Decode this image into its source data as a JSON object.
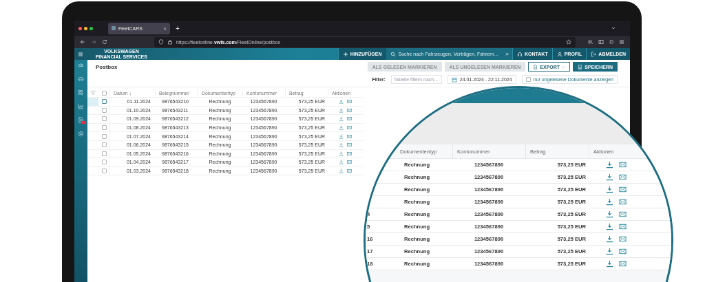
{
  "browser": {
    "tab": {
      "title": "FleetCARS",
      "close": "×",
      "selected": true
    },
    "new_tab": "+",
    "url": {
      "prefix": "https://fleetonline.",
      "domain": "vwfs.com",
      "path": "/FleetOnline/postbox"
    }
  },
  "app_header": {
    "logo": [
      "VOLKSWAGEN",
      "FINANCIAL SERVICES"
    ],
    "add_button": "HINZUFÜGEN",
    "search": {
      "placeholder": "Suche nach Fahrzeugen, Verträgen, Fahrern..."
    },
    "search_go": ">",
    "actions": [
      {
        "kind": "contact",
        "label": "KONTAKT"
      },
      {
        "kind": "profile",
        "label": "PROFIL"
      },
      {
        "kind": "logout",
        "label": "ABMELDEN"
      }
    ]
  },
  "sidebar": {
    "items": [
      {
        "kind": "gauge"
      },
      {
        "kind": "car"
      },
      {
        "kind": "fleet"
      },
      {
        "kind": "chart"
      },
      {
        "kind": "document",
        "badge": true
      },
      {
        "kind": "gear"
      }
    ]
  },
  "page": {
    "title": "Postbox",
    "buttons": [
      {
        "kind": "plain",
        "label": "ALS GELESEN MARKIEREN",
        "disabled": true
      },
      {
        "kind": "plain",
        "label": "ALS UNGELESEN MARKIEREN",
        "disabled": true
      },
      {
        "kind": "export",
        "label": "EXPORT",
        "disabled": false
      },
      {
        "kind": "save",
        "label": "SPEICHERN",
        "disabled": false
      }
    ],
    "filter": {
      "label": "Filter:",
      "placeholder": "Tabelle filtern nach...",
      "date_range": "24.01.2024 - 22.11.2024",
      "unread_only": {
        "label": "nur ungelesene Dokumente anzeigen",
        "checked": false
      }
    }
  },
  "table": {
    "select_all": {
      "checked": false
    },
    "columns": [
      "Datum ↓",
      "Belegnummer",
      "Dokumententyp",
      "Kontonummer",
      "Betrag",
      "Aktionen"
    ],
    "rows": [
      {
        "datum": "01.11.2024",
        "beleg": "9876543210",
        "typ": "Rechnung",
        "konto": "1234567890",
        "betrag": "573,25 EUR",
        "selected": true,
        "checked": false
      },
      {
        "datum": "01.10.2024",
        "beleg": "9876543211",
        "typ": "Rechnung",
        "konto": "1234567890",
        "betrag": "573,25 EUR",
        "selected": false,
        "checked": false
      },
      {
        "datum": "01.09.2024",
        "beleg": "9876543212",
        "typ": "Rechnung",
        "konto": "1234567890",
        "betrag": "573,25 EUR",
        "selected": false,
        "checked": false
      },
      {
        "datum": "01.08.2024",
        "beleg": "9876543213",
        "typ": "Rechnung",
        "konto": "1234567890",
        "betrag": "573,25 EUR",
        "selected": false,
        "checked": false
      },
      {
        "datum": "01.07.2024",
        "beleg": "9876543214",
        "typ": "Rechnung",
        "konto": "1234567890",
        "betrag": "573,25 EUR",
        "selected": false,
        "checked": false
      },
      {
        "datum": "01.06.2024",
        "beleg": "9876543215",
        "typ": "Rechnung",
        "konto": "1234567890",
        "betrag": "573,25 EUR",
        "selected": false,
        "checked": false
      },
      {
        "datum": "01.05.2024",
        "beleg": "9876543216",
        "typ": "Rechnung",
        "konto": "1234567890",
        "betrag": "573,25 EUR",
        "selected": false,
        "checked": false
      },
      {
        "datum": "01.04.2024",
        "beleg": "9876543217",
        "typ": "Rechnung",
        "konto": "1234567890",
        "betrag": "573,25 EUR",
        "selected": false,
        "checked": false
      },
      {
        "datum": "01.03.2024",
        "beleg": "9876543218",
        "typ": "Rechnung",
        "konto": "1234567890",
        "betrag": "573,25 EUR",
        "selected": false,
        "checked": false
      }
    ]
  },
  "magnifier": {
    "columns": [
      "Dokumententyp",
      "Kontonummer",
      "Betrag",
      "Aktionen"
    ],
    "rows": [
      {
        "typ": "Rechnung",
        "konto": "1234567890",
        "betrag": "573,25 EUR"
      },
      {
        "typ": "Rechnung",
        "konto": "1234567890",
        "betrag": "573,25 EUR"
      },
      {
        "typ": "Rechnung",
        "konto": "1234567890",
        "betrag": "573,25 EUR"
      },
      {
        "typ": "Rechnung",
        "konto": "1234567890",
        "betrag": "573,25 EUR"
      },
      {
        "column_1": "4",
        "typ": "Rechnung",
        "konto": "1234567890",
        "betrag": "573,25 EUR"
      },
      {
        "column_1": "5",
        "typ": "Rechnung",
        "konto": "1234567890",
        "betrag": "573,25 EUR"
      },
      {
        "column_1": "16",
        "typ": "Rechnung",
        "konto": "1234567890",
        "betrag": "573,25 EUR"
      },
      {
        "column_1": "17",
        "typ": "Rechnung",
        "konto": "1234567890",
        "betrag": "573,25 EUR"
      },
      {
        "column_1": "18",
        "typ": "Rechnung",
        "konto": "1234567890",
        "betrag": "573,25 EUR"
      }
    ]
  }
}
